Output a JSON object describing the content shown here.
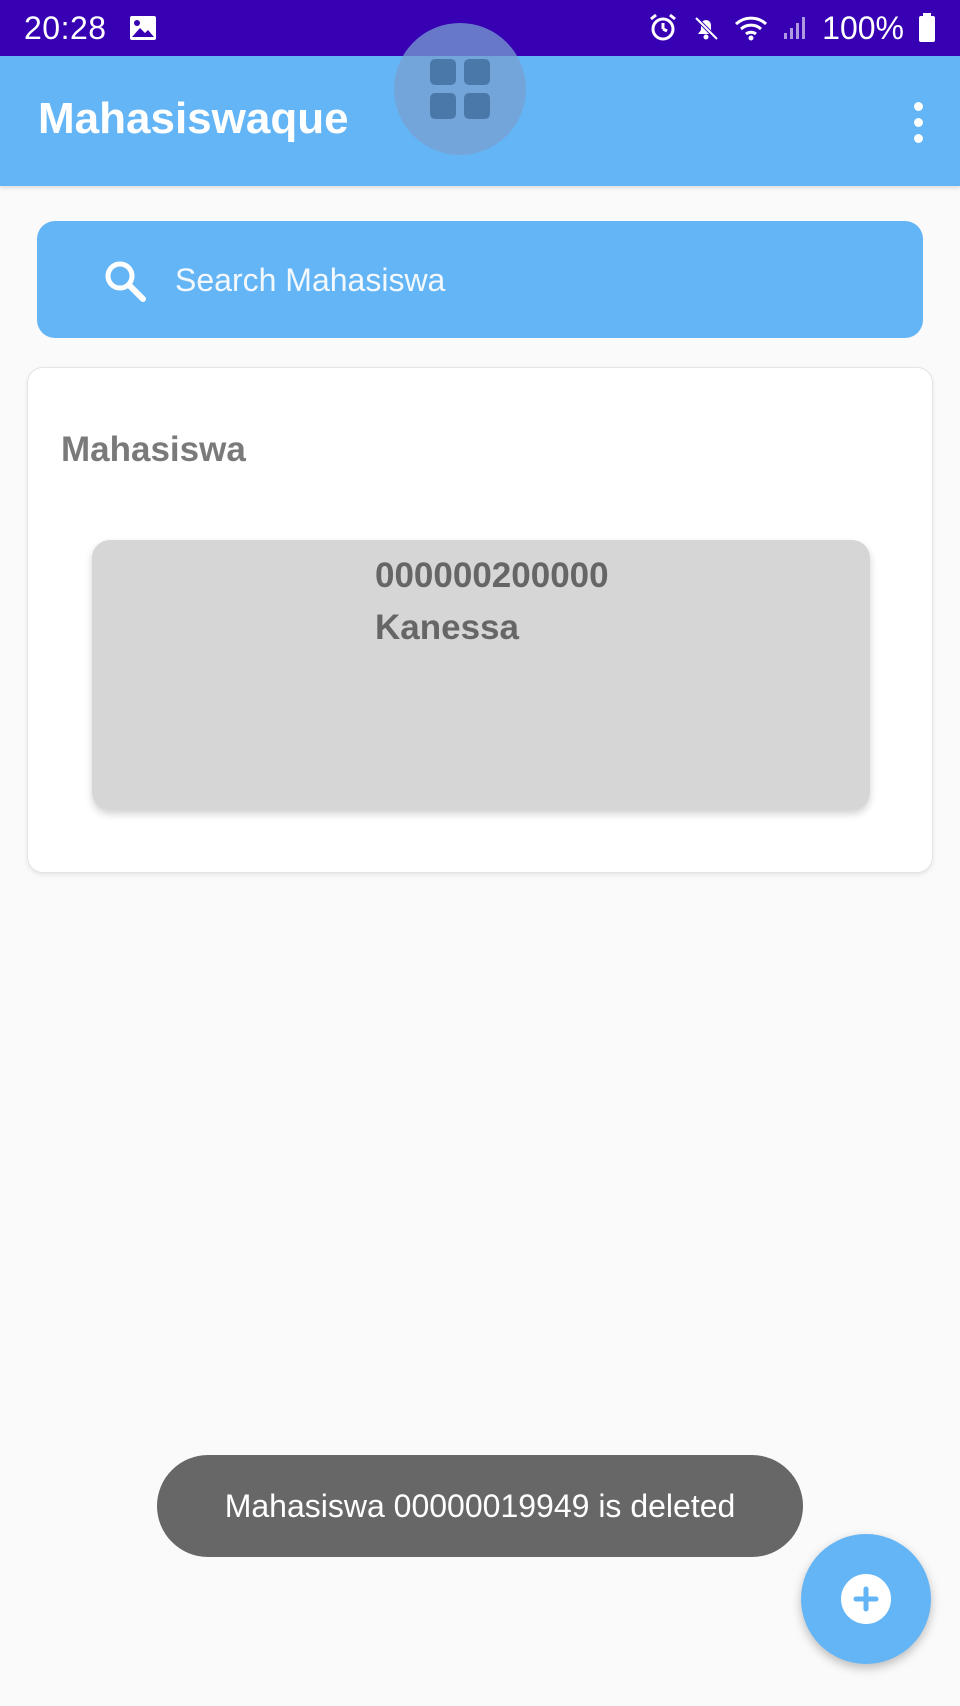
{
  "status_bar": {
    "time": "20:28",
    "battery_percent": "100%",
    "icons": [
      "image-icon",
      "alarm-icon",
      "mute-icon",
      "wifi-icon",
      "signal-icon",
      "battery-icon"
    ]
  },
  "app_bar": {
    "title": "Mahasiswaque",
    "menu_icon": "overflow-menu-icon",
    "floating_icon": "grid-icon"
  },
  "search": {
    "placeholder": "Search Mahasiswa",
    "value": "",
    "icon": "search-icon"
  },
  "list": {
    "title": "Mahasiswa",
    "items": [
      {
        "nim": "000000200000",
        "name": "Kanessa"
      }
    ]
  },
  "toast": {
    "message": "Mahasiswa 00000019949 is deleted"
  },
  "fab": {
    "icon": "add-circle-icon"
  },
  "colors": {
    "status_bar": "#3700b3",
    "primary": "#64b5f6",
    "card_item": "#d6d6d6",
    "toast": "#676767",
    "background": "#fafafa"
  }
}
